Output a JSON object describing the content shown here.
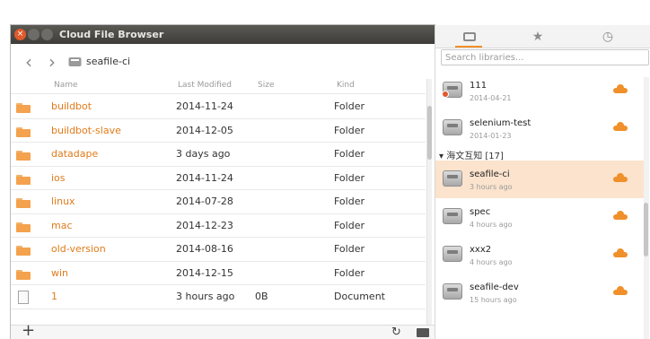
{
  "window": {
    "title": "Cloud File Browser",
    "breadcrumb": "seafile-ci"
  },
  "table": {
    "columns": [
      "Name",
      "Last Modified",
      "Size",
      "Kind"
    ],
    "rows": [
      {
        "name": "buildbot",
        "modified": "2014-11-24",
        "size": "",
        "kind": "Folder",
        "icon": "folder-icon"
      },
      {
        "name": "buildbot-slave",
        "modified": "2014-12-05",
        "size": "",
        "kind": "Folder",
        "icon": "folder-icon"
      },
      {
        "name": "datadape",
        "modified": "3 days ago",
        "size": "",
        "kind": "Folder",
        "icon": "folder-icon"
      },
      {
        "name": "ios",
        "modified": "2014-11-24",
        "size": "",
        "kind": "Folder",
        "icon": "folder-icon"
      },
      {
        "name": "linux",
        "modified": "2014-07-28",
        "size": "",
        "kind": "Folder",
        "icon": "folder-icon"
      },
      {
        "name": "mac",
        "modified": "2014-12-23",
        "size": "",
        "kind": "Folder",
        "icon": "folder-icon"
      },
      {
        "name": "old-version",
        "modified": "2014-08-16",
        "size": "",
        "kind": "Folder",
        "icon": "folder-icon"
      },
      {
        "name": "win",
        "modified": "2014-12-15",
        "size": "",
        "kind": "Folder",
        "icon": "folder-icon"
      },
      {
        "name": "1",
        "modified": "3 hours ago",
        "size": "0B",
        "kind": "Document",
        "icon": "document-icon"
      }
    ]
  },
  "bottom_bar": {
    "add": "+",
    "refresh": "↻"
  },
  "panel": {
    "tabs": [
      "libraries-icon",
      "star-icon",
      "clock-icon"
    ],
    "search_placeholder": "Search libraries...",
    "group_label": "▾ 海文互知 [17]",
    "libraries": [
      {
        "name": "111",
        "time": "2014-04-21",
        "synced": true,
        "selected": false,
        "alert": true
      },
      {
        "name": "selenium-test",
        "time": "2014-01-23",
        "synced": true,
        "selected": false,
        "alert": false
      },
      {
        "name": "seafile-ci",
        "time": "3 hours ago",
        "synced": true,
        "selected": true,
        "alert": false
      },
      {
        "name": "spec",
        "time": "4 hours ago",
        "synced": true,
        "selected": false,
        "alert": false
      },
      {
        "name": "xxx2",
        "time": "4 hours ago",
        "synced": true,
        "selected": false,
        "alert": false
      },
      {
        "name": "seafile-dev",
        "time": "15 hours ago",
        "synced": true,
        "selected": false,
        "alert": false
      }
    ]
  },
  "colors": {
    "accent": "#f0902b",
    "folder_name": "#e07b1a",
    "selected_row": "#fbe3cd"
  }
}
